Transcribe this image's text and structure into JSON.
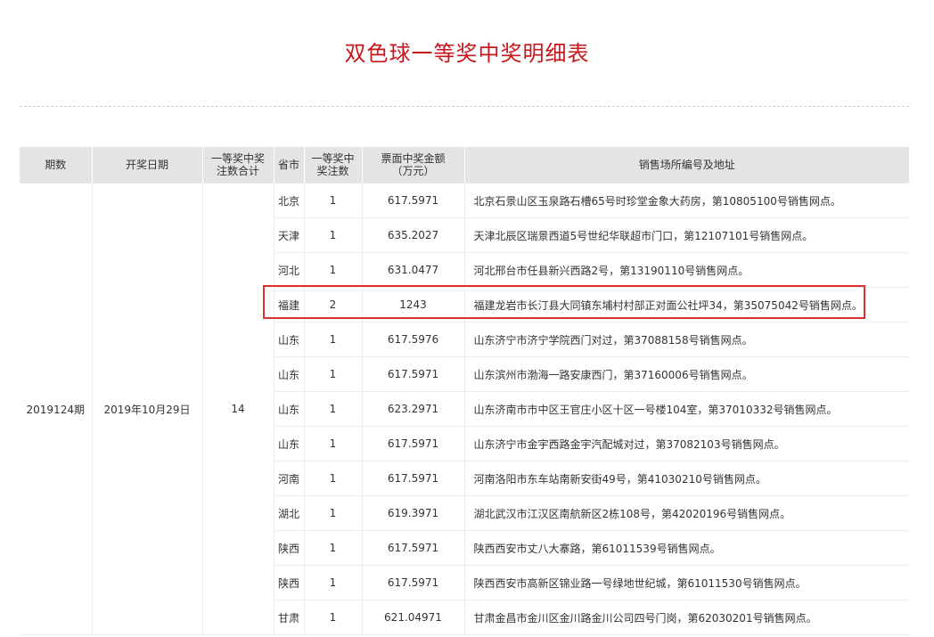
{
  "page": {
    "title": "双色球一等奖中奖明细表"
  },
  "table": {
    "headers": {
      "issue": "期数",
      "date": "开奖日期",
      "total": "一等奖中奖注数合计",
      "province": "省市",
      "count": "一等奖中奖注数",
      "amount": "票面中奖金额（万元）",
      "address": "销售场所编号及地址"
    },
    "issue": "2019124期",
    "date": "2019年10月29日",
    "total": "14",
    "rows": [
      {
        "province": "北京",
        "count": "1",
        "amount": "617.5971",
        "address": "北京石景山区玉泉路石槽65号时珍堂金象大药房，第10805100号销售网点。"
      },
      {
        "province": "天津",
        "count": "1",
        "amount": "635.2027",
        "address": "天津北辰区瑞景西道5号世纪华联超市门口，第12107101号销售网点。"
      },
      {
        "province": "河北",
        "count": "1",
        "amount": "631.0477",
        "address": "河北邢台市任县新兴西路2号，第13190110号销售网点。"
      },
      {
        "province": "福建",
        "count": "2",
        "amount": "1243",
        "address": "福建龙岩市长汀县大同镇东埔村村部正对面公社坪34，第35075042号销售网点。"
      },
      {
        "province": "山东",
        "count": "1",
        "amount": "617.5976",
        "address": "山东济宁市济宁学院西门对过，第37088158号销售网点。"
      },
      {
        "province": "山东",
        "count": "1",
        "amount": "617.5971",
        "address": "山东滨州市渤海一路安康西门，第37160006号销售网点。"
      },
      {
        "province": "山东",
        "count": "1",
        "amount": "623.2971",
        "address": "山东济南市市中区王官庄小区十区一号楼104室，第37010332号销售网点。"
      },
      {
        "province": "山东",
        "count": "1",
        "amount": "617.5971",
        "address": "山东济宁市金宇西路金宇汽配城对过，第37082103号销售网点。"
      },
      {
        "province": "河南",
        "count": "1",
        "amount": "617.5971",
        "address": "河南洛阳市东车站南新安街49号，第41030210号销售网点。"
      },
      {
        "province": "湖北",
        "count": "1",
        "amount": "619.3971",
        "address": "湖北武汉市江汉区南航新区2栋108号，第42020196号销售网点。"
      },
      {
        "province": "陕西",
        "count": "1",
        "amount": "617.5971",
        "address": "陕西西安市丈八大寨路，第61011539号销售网点。"
      },
      {
        "province": "陕西",
        "count": "1",
        "amount": "617.5971",
        "address": "陕西西安市高新区锦业路一号绿地世纪城，第61011530号销售网点。"
      },
      {
        "province": "甘肃",
        "count": "1",
        "amount": "621.04971",
        "address": "甘肃金昌市金川区金川路金川公司四号门岗，第62030201号销售网点。"
      }
    ],
    "highlighted_row": 3
  },
  "colors": {
    "title": "#c8161d",
    "header_bg": "#e4e4e4",
    "highlight_border": "#e03131"
  }
}
